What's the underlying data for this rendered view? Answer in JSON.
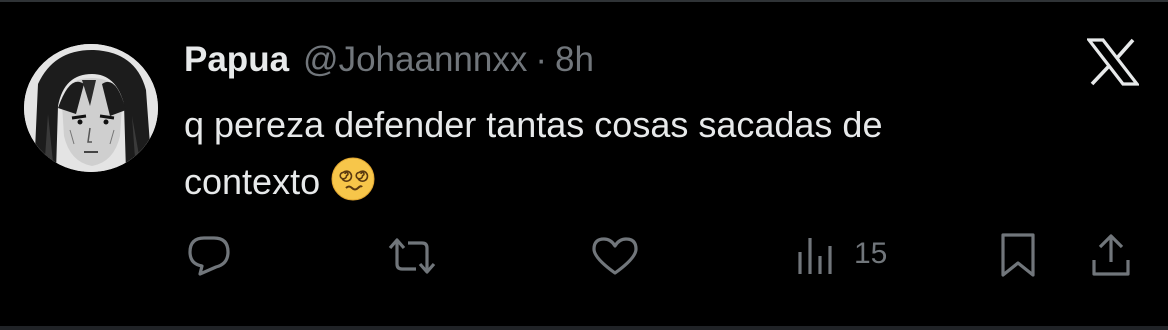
{
  "tweet": {
    "display_name": "Papua",
    "handle": "@Johaannnxx",
    "separator": "·",
    "time": "8h",
    "text_line1": "q pereza defender tantas cosas sacadas de",
    "text_line2": "contexto",
    "emoji": "face-with-spiral-eyes"
  },
  "actions": {
    "reply_icon": "reply-icon",
    "retweet_icon": "retweet-icon",
    "like_icon": "heart-icon",
    "views_icon": "views-icon",
    "views_count": "15",
    "bookmark_icon": "bookmark-icon",
    "share_icon": "share-icon"
  },
  "colors": {
    "background": "#000000",
    "primary_text": "#e7e9ea",
    "secondary_text": "#71767b",
    "emoji_yellow": "#f7c64a"
  }
}
